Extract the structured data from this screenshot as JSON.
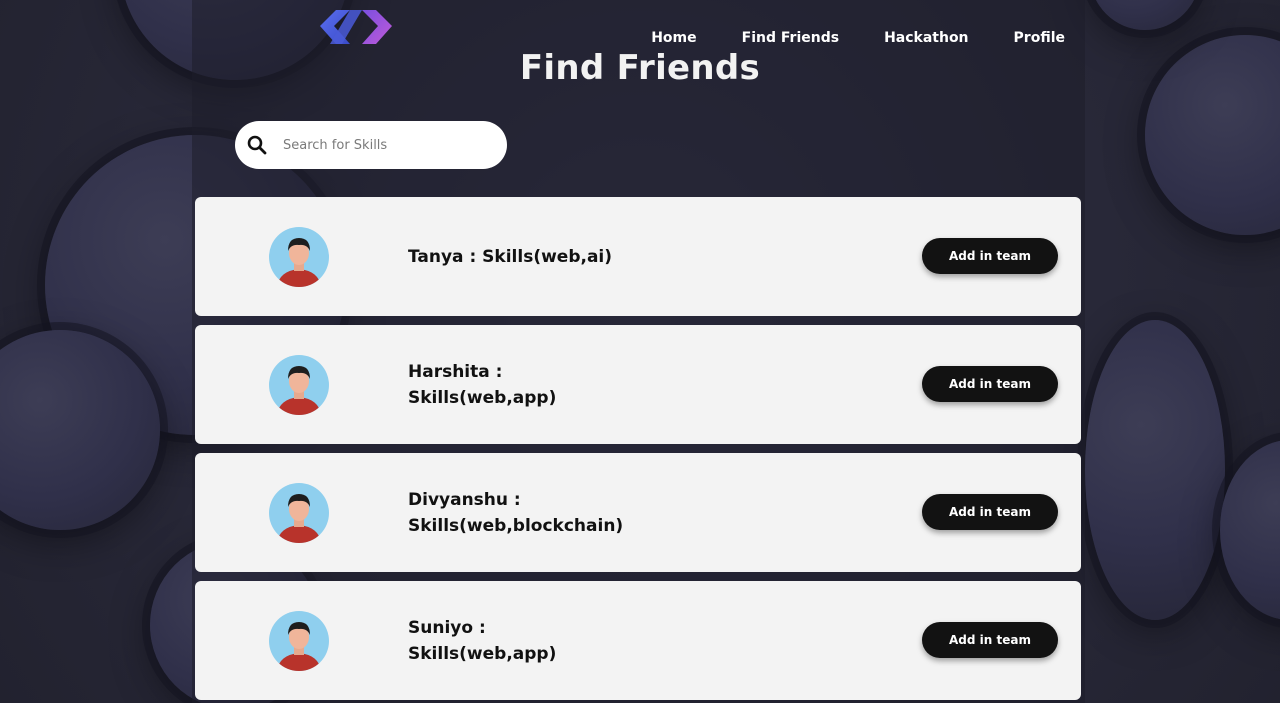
{
  "nav": {
    "items": [
      "Home",
      "Find Friends",
      "Hackathon",
      "Profile"
    ]
  },
  "page": {
    "title": "Find Friends"
  },
  "search": {
    "placeholder": "Search for Skills",
    "icon": "search-icon"
  },
  "people": [
    {
      "name": "Tanya",
      "skills": "Skills(web,ai)",
      "label": "Tanya : Skills(web,ai)",
      "button": "Add in team"
    },
    {
      "name": "Harshita",
      "skills": "Skills(web,app)",
      "label": "Harshita : Skills(web,app)",
      "button": "Add in team"
    },
    {
      "name": "Divyanshu",
      "skills": "Skills(web,blockchain)",
      "label": "Divyanshu : Skills(web,blockchain)",
      "button": "Add in team"
    },
    {
      "name": "Suniyo",
      "skills": "Skills(web,app)",
      "label": "Suniyo : Skills(web,app)",
      "button": "Add in team"
    }
  ],
  "colors": {
    "card_background": "#f3f3f3",
    "button_background": "#121212",
    "avatar_background": "#8fcfee",
    "logo_blue": "#3f5fd8",
    "logo_purple": "#a84fd8"
  }
}
